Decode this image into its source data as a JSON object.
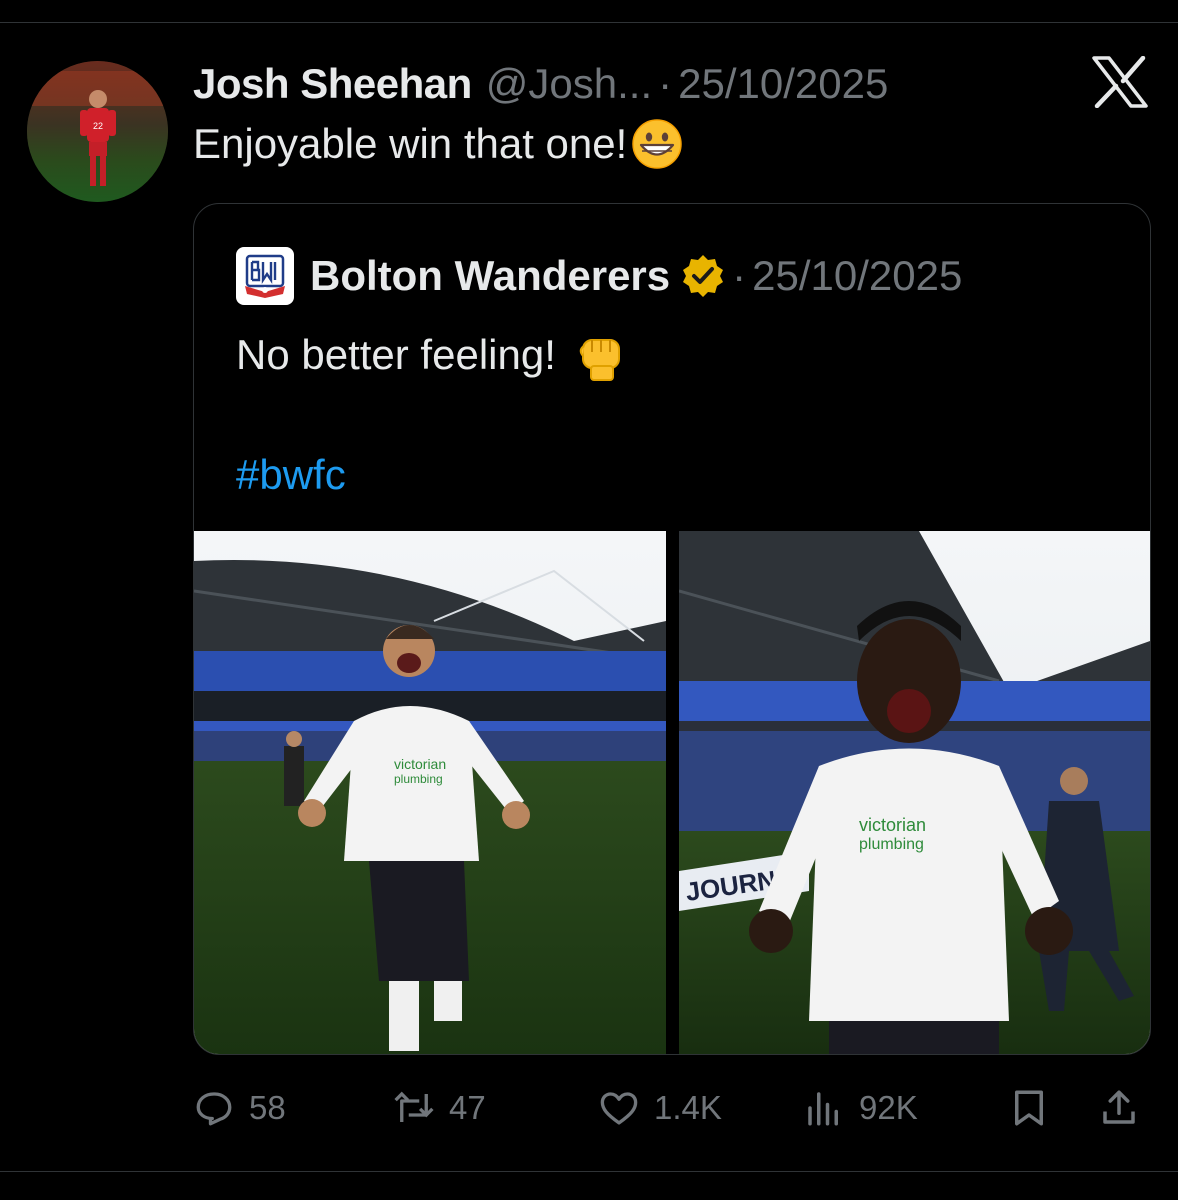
{
  "post": {
    "author_name": "Josh Sheehan",
    "author_handle": "@Josh...",
    "separator": "·",
    "date": "25/10/2025",
    "text": "Enjoyable win that one!",
    "text_emoji": "grinning-face-emoji"
  },
  "quoted_post": {
    "author_name": "Bolton Wanderers",
    "verified": "gold-verified-badge",
    "separator": "·",
    "date": "25/10/2025",
    "text": "No better feeling!",
    "text_emoji": "raised-fist-emoji",
    "hashtag": "#bwfc",
    "images": [
      {
        "subject": "player celebrating on pitch, white kit, bearded",
        "sponsor": "victorian plumbing"
      },
      {
        "subject": "player shouting with clenched fists, white kit",
        "sponsor": "victorian plumbing",
        "board_text": "JOURNEY"
      }
    ]
  },
  "actions": {
    "replies": "58",
    "reposts": "47",
    "likes": "1.4K",
    "views": "92K"
  },
  "icons": [
    "reply-icon",
    "repost-icon",
    "like-icon",
    "views-icon",
    "bookmark-icon",
    "share-icon",
    "x-logo-icon"
  ],
  "colors": {
    "background": "#000000",
    "text": "#e7e9ea",
    "muted": "#71767b",
    "link": "#1d9bf0",
    "border": "#2f3336"
  }
}
